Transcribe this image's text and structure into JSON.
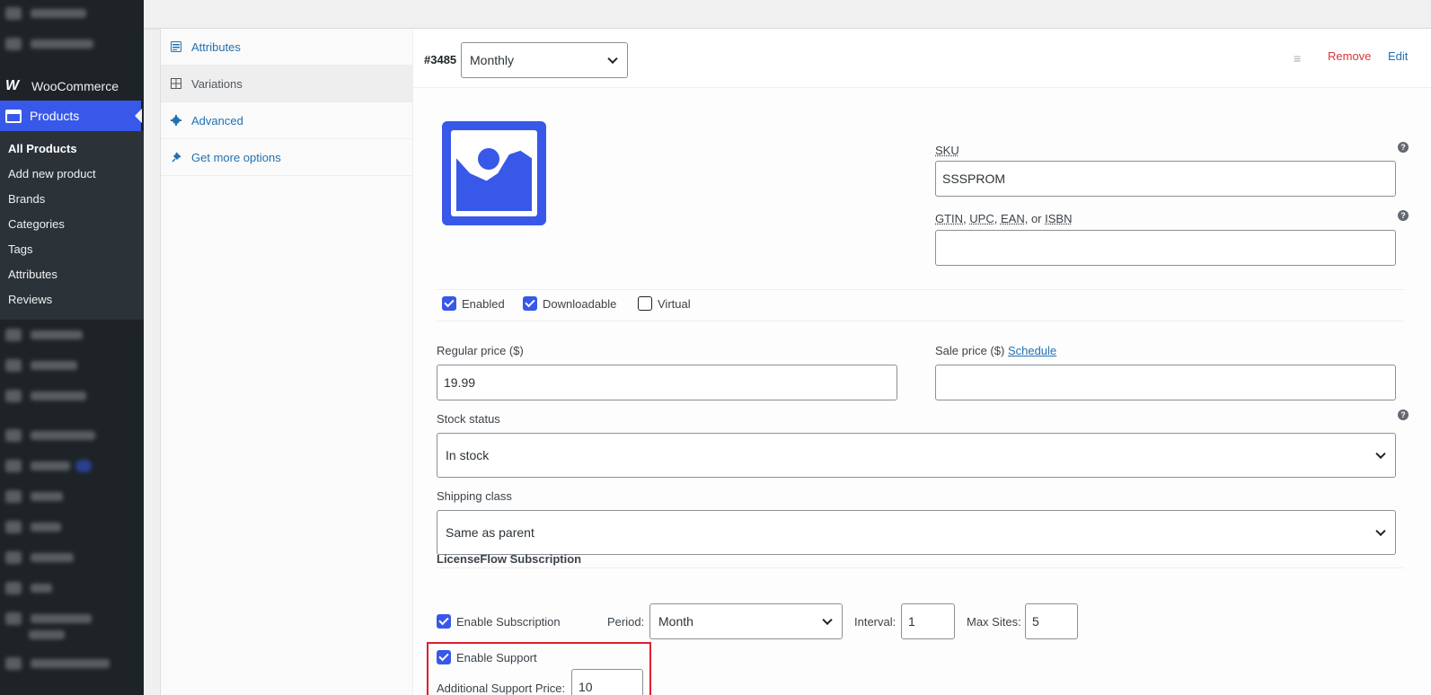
{
  "menu": {
    "woocommerce": "WooCommerce",
    "products": "Products",
    "submenu": [
      "All Products",
      "Add new product",
      "Brands",
      "Categories",
      "Tags",
      "Attributes",
      "Reviews"
    ]
  },
  "tabs": [
    {
      "label": "Attributes",
      "icon": "list-icon"
    },
    {
      "label": "Variations",
      "icon": "grid-icon"
    },
    {
      "label": "Advanced",
      "icon": "gear-icon"
    },
    {
      "label": "Get more options",
      "icon": "plug-icon"
    }
  ],
  "variation": {
    "id": "#3485",
    "attribute_value": "Monthly",
    "remove_label": "Remove",
    "edit_label": "Edit",
    "sku_label": "SKU",
    "sku_value": "SSSPROM",
    "gtin_label_parts": [
      "GTIN",
      ", ",
      "UPC",
      ", ",
      "EAN",
      ", or ",
      "ISBN"
    ],
    "gtin_value": "",
    "enabled_label": "Enabled",
    "enabled": true,
    "downloadable_label": "Downloadable",
    "downloadable": true,
    "virtual_label": "Virtual",
    "virtual": false,
    "regular_price_label": "Regular price ($)",
    "regular_price_value": "19.99",
    "sale_price_label": "Sale price ($)",
    "schedule_label": "Schedule",
    "sale_price_value": "",
    "stock_status_label": "Stock status",
    "stock_status_value": "In stock",
    "shipping_class_label": "Shipping class",
    "shipping_class_value": "Same as parent"
  },
  "subscription": {
    "title": "LicenseFlow Subscription",
    "enable_label": "Enable Subscription",
    "enabled": true,
    "period_label": "Period:",
    "period_value": "Month",
    "interval_label": "Interval:",
    "interval_value": "1",
    "max_sites_label": "Max Sites:",
    "max_sites_value": "5",
    "support_label": "Enable Support",
    "support_enabled": true,
    "support_price_label": "Additional Support Price:",
    "support_price_value": "10"
  },
  "colors": {
    "accent": "#3858e9",
    "highlight": "#e01e2e",
    "link": "#2271b1",
    "remove": "#d63638"
  }
}
